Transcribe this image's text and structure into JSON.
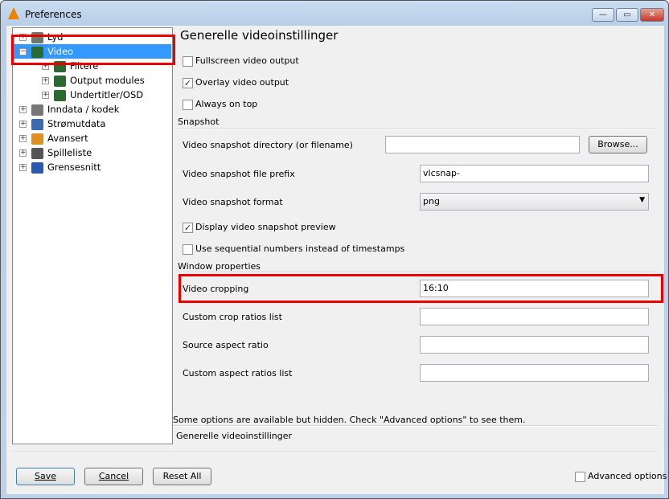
{
  "window": {
    "title": "Preferences",
    "minimize": "—",
    "maximize": "▭",
    "close": "✕"
  },
  "tree": [
    {
      "label": "Lyd",
      "expander": "+",
      "icon": "speaker-icon",
      "color": "#6a7a6a"
    },
    {
      "label": "Video",
      "expander": "−",
      "icon": "video-icon",
      "color": "#2a6a30",
      "selected": true
    },
    {
      "label": "Filtere",
      "expander": "+",
      "icon": "video-icon",
      "color": "#2a6a30"
    },
    {
      "label": "Output modules",
      "expander": "+",
      "icon": "video-icon",
      "color": "#2a6a30"
    },
    {
      "label": "Undertitler/OSD",
      "expander": "+",
      "icon": "video-icon",
      "color": "#2a6a30"
    },
    {
      "label": "Inndata / kodek",
      "expander": "+",
      "icon": "input-codec-icon",
      "color": "#777"
    },
    {
      "label": "Strømutdata",
      "expander": "+",
      "icon": "globe-icon",
      "color": "#3a6ab0"
    },
    {
      "label": "Avansert",
      "expander": "+",
      "icon": "wrench-icon",
      "color": "#e09020"
    },
    {
      "label": "Spilleliste",
      "expander": "+",
      "icon": "playlist-icon",
      "color": "#555"
    },
    {
      "label": "Grensesnitt",
      "expander": "+",
      "icon": "interface-icon",
      "color": "#2a5ab0"
    }
  ],
  "main": {
    "heading": "Generelle videoinstillinger",
    "fullscreen": {
      "label": "Fullscreen video output",
      "checked": false
    },
    "overlay": {
      "label": "Overlay video output",
      "checked": true
    },
    "ontop": {
      "label": "Always on top",
      "checked": false
    },
    "snapshot_section": "Snapshot",
    "snap_dir": {
      "label": "Video snapshot directory (or filename)",
      "value": ""
    },
    "browse": "Browse...",
    "snap_prefix": {
      "label": "Video snapshot file prefix",
      "value": "vlcsnap-"
    },
    "snap_format": {
      "label": "Video snapshot format",
      "value": "png"
    },
    "snap_preview": {
      "label": "Display video snapshot preview",
      "checked": true
    },
    "snap_seq": {
      "label": "Use sequential numbers instead of timestamps",
      "checked": false
    },
    "window_section": "Window properties",
    "crop": {
      "label": "Video cropping",
      "value": "16:10"
    },
    "crop_list": {
      "label": "Custom crop ratios list",
      "value": ""
    },
    "source_aspect": {
      "label": "Source aspect ratio",
      "value": ""
    },
    "aspect_list": {
      "label": "Custom aspect ratios list",
      "value": ""
    },
    "hidden_note": "Some options are available but hidden. Check \"Advanced options\" to see them.",
    "footer_title": "Generelle videoinstillinger"
  },
  "buttons": {
    "save": "Save",
    "cancel": "Cancel",
    "reset": "Reset All",
    "advanced": "Advanced options"
  }
}
